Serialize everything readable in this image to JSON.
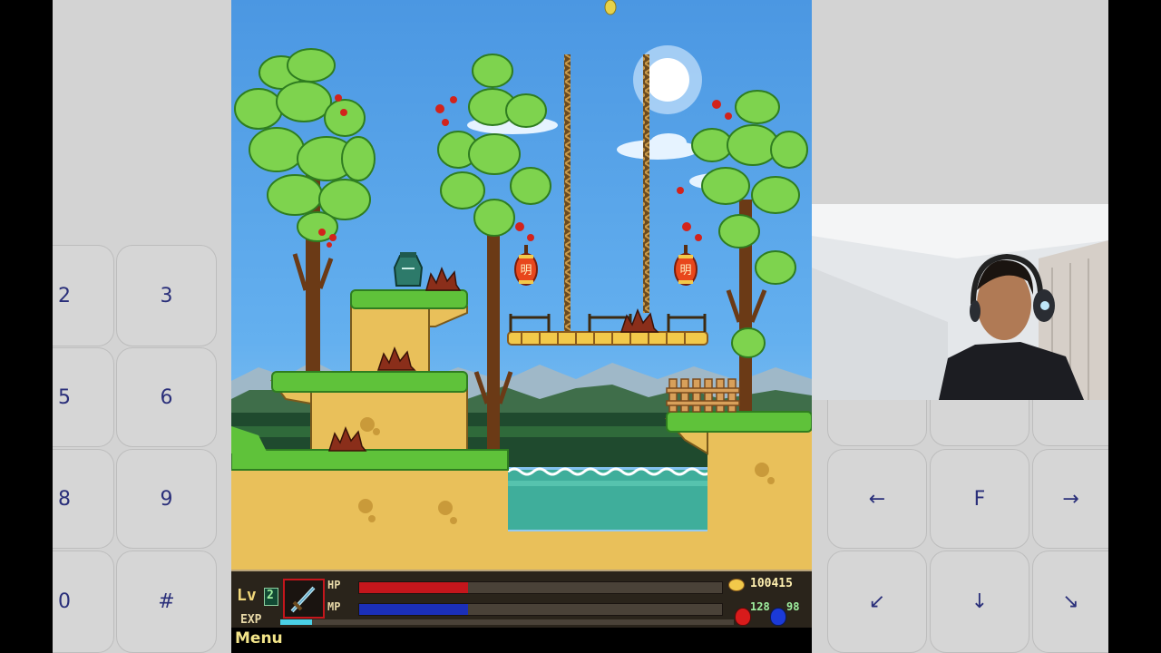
{
  "keypad_left": [
    "2",
    "3",
    "5",
    "6",
    "8",
    "9",
    "0",
    "#"
  ],
  "keypad_right": {
    "top_row": [
      "←",
      "F",
      "→"
    ],
    "bottom_row": [
      "↙",
      "↓",
      "↘"
    ]
  },
  "game": {
    "level_label": "Lv",
    "level_value": "2",
    "hp_label": "HP",
    "mp_label": "MP",
    "exp_label": "EXP",
    "hp_fraction": 0.3,
    "mp_fraction": 0.3,
    "exp_fraction": 0.07,
    "gold": "100415",
    "hp_potions": "128",
    "mp_potions": "98",
    "menu_label": "Menu",
    "lantern_char": "明"
  },
  "colors": {
    "sky": "#4f9fe6",
    "grass": "#5fc23a",
    "dirt": "#e9c05a",
    "water": "#3fae9b",
    "panel": "#d3d3d3",
    "key_text": "#2a2f7a",
    "hp_bar": "#c4161c",
    "mp_bar": "#1b2fb8"
  }
}
